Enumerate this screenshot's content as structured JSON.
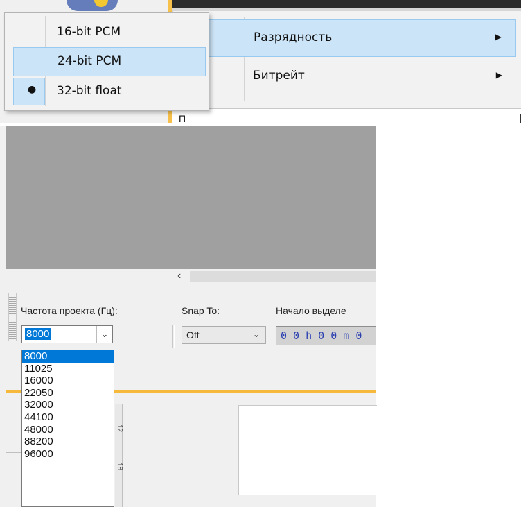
{
  "submenu": {
    "items": [
      {
        "label": "16-bit PCM",
        "checked": false
      },
      {
        "label": "24-bit PCM",
        "checked": false,
        "highlighted": true
      },
      {
        "label": "32-bit float",
        "checked": true
      }
    ],
    "bullet": "●"
  },
  "menu": {
    "items": [
      {
        "label": "Разрядность",
        "arrow": "▶"
      },
      {
        "label": "Битрейт",
        "arrow": "▶"
      }
    ],
    "partial_text": "П"
  },
  "toolbar": {
    "rate_label": "Частота проекта (Гц):",
    "rate_value": "8000",
    "rate_arrow": "⌄",
    "snap_label": "Snap To:",
    "snap_value": "Off",
    "snap_arrow": "⌄",
    "start_label": "Начало выделе",
    "start_time": "0 0 h 0 0 m 0"
  },
  "scroll": {
    "left_arrow": "‹"
  },
  "ruler": {
    "marks": [
      "12",
      "18"
    ]
  },
  "rate_options": [
    "8000",
    "11025",
    "16000",
    "22050",
    "32000",
    "44100",
    "48000",
    "88200",
    "96000"
  ],
  "colors": {
    "highlight": "#cce4f7",
    "highlight_border": "#99c9ef",
    "selection": "#0078d7",
    "time_digits": "#2a3fb0",
    "orange": "#f6b93b"
  }
}
